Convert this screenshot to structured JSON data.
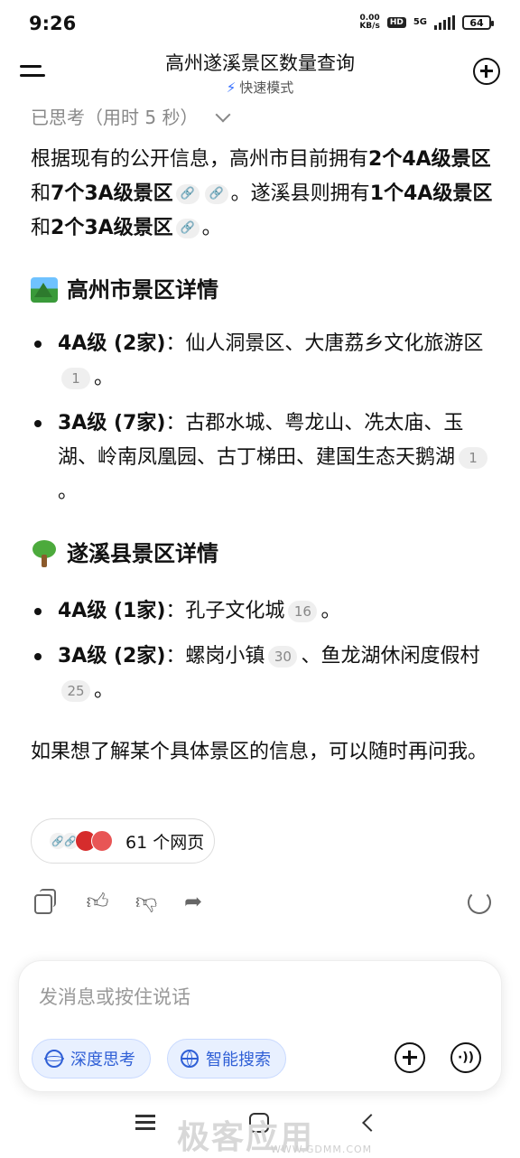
{
  "status_bar": {
    "time": "9:26",
    "net_speed_value": "0.00",
    "net_speed_unit": "KB/s",
    "hd": "HD",
    "network": "5G",
    "battery": "64"
  },
  "header": {
    "title": "高州遂溪景区数量查询",
    "mode": "快速模式"
  },
  "thinking": {
    "label": "已思考（用时 5 秒）"
  },
  "answer": {
    "intro": {
      "t1": "根据现有的公开信息，高州市目前拥有",
      "b1": "2个4A级景区",
      "t2": "和",
      "b2": "7个3A级景区",
      "t3": "。遂溪县则拥有",
      "b3": "1个4A级景区",
      "t4": "和",
      "b4": "2个3A级景区",
      "t5": "。"
    },
    "section1": {
      "title": "高州市景区详情",
      "items": [
        {
          "label": "4A级 (2家)",
          "text": "：仙人洞景区、大唐荔乡文化旅游区",
          "ref": "1",
          "end": "。"
        },
        {
          "label": "3A级 (7家)",
          "text": "：古郡水城、粤龙山、冼太庙、玉湖、岭南凤凰园、古丁梯田、建国生态天鹅湖",
          "ref": "1",
          "end": "。"
        }
      ]
    },
    "section2": {
      "title": "遂溪县景区详情",
      "items": [
        {
          "label": "4A级 (1家)",
          "text": "：孔子文化城",
          "ref": "16",
          "end": "。"
        },
        {
          "label": "3A级 (2家)",
          "text": "：螺岗小镇",
          "ref": "30",
          "mid": "、鱼龙湖休闲度假村",
          "ref2": "25",
          "end": "。"
        }
      ]
    },
    "outro": "如果想了解某个具体景区的信息，可以随时再问我。"
  },
  "sources": {
    "label": "61 个网页"
  },
  "composer": {
    "placeholder": "发消息或按住说话",
    "deep_think": "深度思考",
    "smart_search": "智能搜索"
  },
  "watermark": {
    "main": "极客应用",
    "sub": "WWW.GDMM.COM"
  }
}
